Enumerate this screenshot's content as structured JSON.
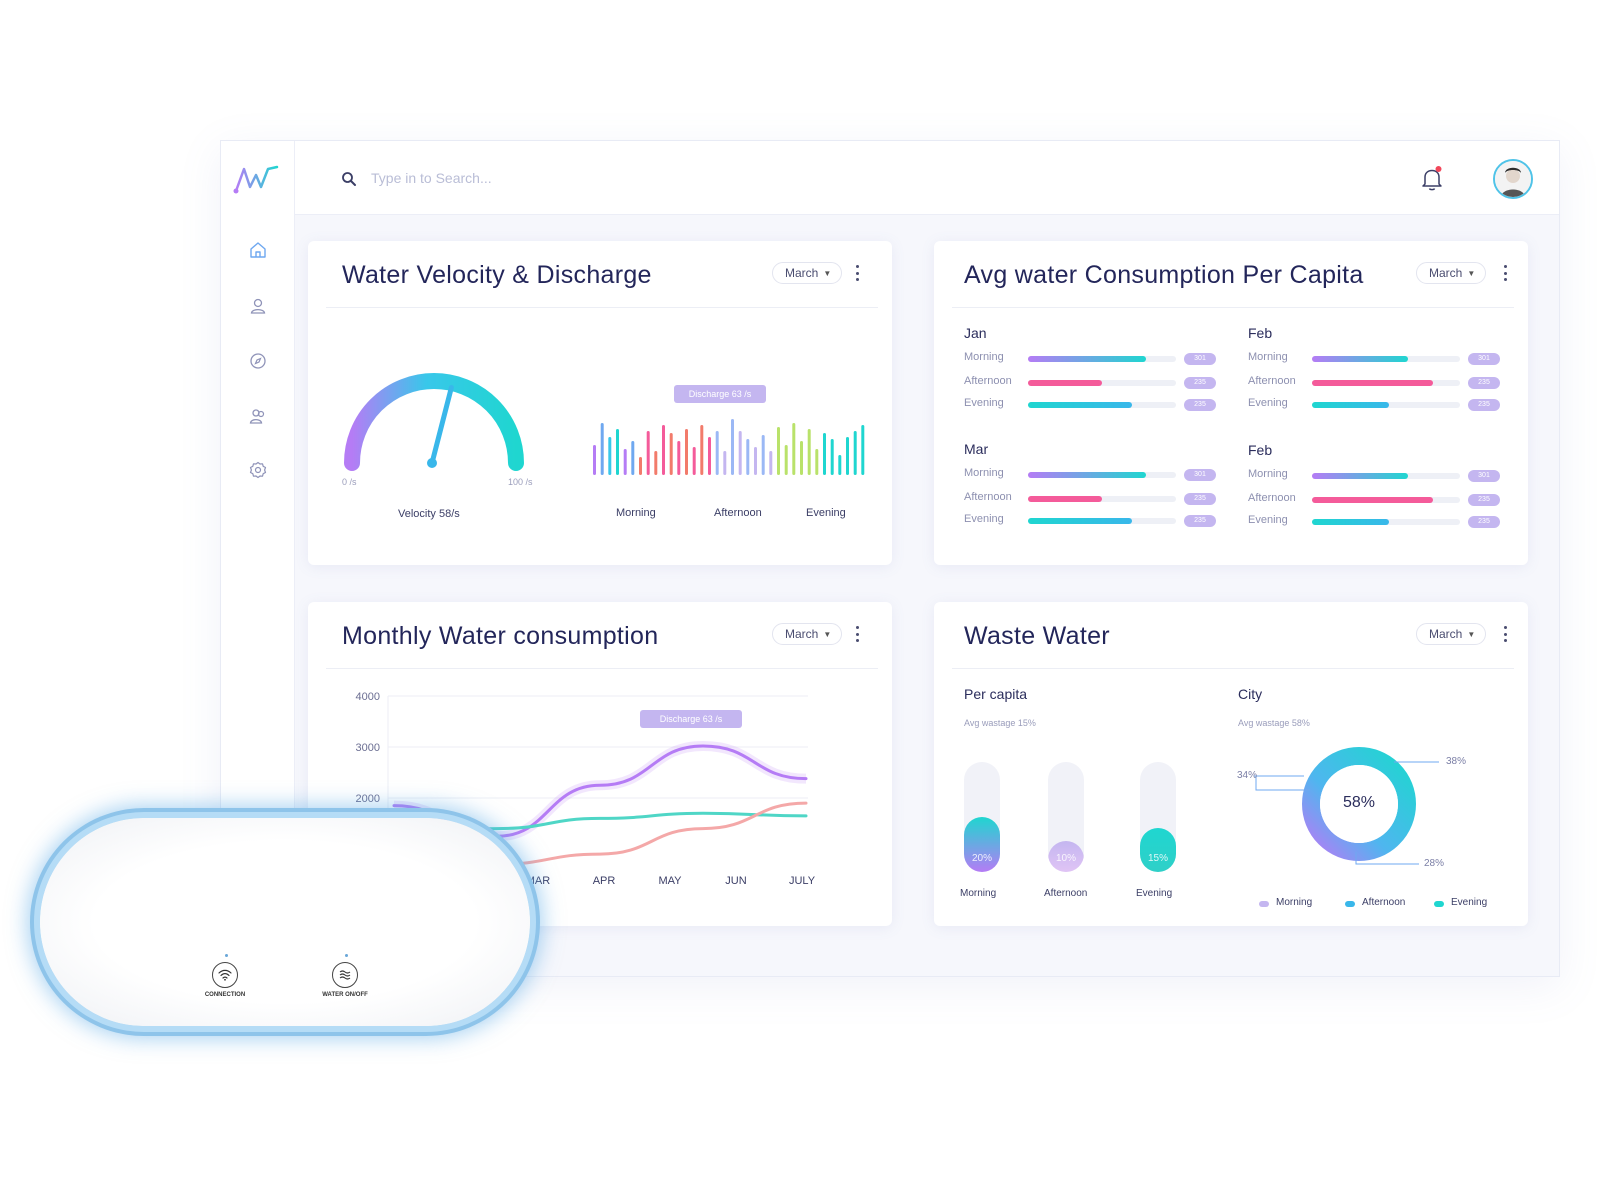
{
  "search": {
    "placeholder": "Type in to Search..."
  },
  "nav": [
    "home-icon",
    "user-icon",
    "compass-icon",
    "users-icon",
    "gear-icon"
  ],
  "colors": {
    "accent_teal": "#1fd6d0",
    "accent_purple": "#b57cf5",
    "accent_pink": "#f45b9a",
    "notification": "#f2475a"
  },
  "velocity_card": {
    "title": "Water Velocity & Discharge",
    "dropdown": "March",
    "gauge": {
      "min_label": "0 /s",
      "max_label": "100 /s",
      "value": 58,
      "caption": "Velocity 58/s"
    },
    "discharge_tooltip": "Discharge 63 /s",
    "bar_labels": [
      "Morning",
      "Afternoon",
      "Evening"
    ]
  },
  "consumption_card": {
    "title": "Avg water Consumption Per Capita",
    "dropdown": "March",
    "groups": [
      {
        "title": "Jan",
        "rows": [
          {
            "label": "Morning",
            "fill": 0.8,
            "badge": "301"
          },
          {
            "label": "Afternoon",
            "fill": 0.5,
            "badge": "235"
          },
          {
            "label": "Evening",
            "fill": 0.7,
            "badge": "235"
          }
        ]
      },
      {
        "title": "Feb",
        "rows": [
          {
            "label": "Morning",
            "fill": 0.65,
            "badge": "301"
          },
          {
            "label": "Afternoon",
            "fill": 0.82,
            "badge": "235"
          },
          {
            "label": "Evening",
            "fill": 0.52,
            "badge": "235"
          }
        ]
      },
      {
        "title": "Mar",
        "rows": [
          {
            "label": "Morning",
            "fill": 0.8,
            "badge": "301"
          },
          {
            "label": "Afternoon",
            "fill": 0.5,
            "badge": "235"
          },
          {
            "label": "Evening",
            "fill": 0.7,
            "badge": "235"
          }
        ]
      },
      {
        "title": "Feb",
        "rows": [
          {
            "label": "Morning",
            "fill": 0.65,
            "badge": "301"
          },
          {
            "label": "Afternoon",
            "fill": 0.82,
            "badge": "235"
          },
          {
            "label": "Evening",
            "fill": 0.52,
            "badge": "235"
          }
        ]
      }
    ]
  },
  "monthly_card": {
    "title": "Monthly Water consumption",
    "dropdown": "March",
    "tooltip": "Discharge 63 /s"
  },
  "waste_card": {
    "title": "Waste Water",
    "dropdown": "March",
    "per_capita": {
      "title": "Per capita",
      "subtitle": "Avg wastage 15%",
      "bars": [
        {
          "label": "Morning",
          "pct": "20%",
          "value": 0.5
        },
        {
          "label": "Afternoon",
          "pct": "10%",
          "value": 0.28
        },
        {
          "label": "Evening",
          "pct": "15%",
          "value": 0.4
        }
      ]
    },
    "city": {
      "title": "City",
      "subtitle": "Avg wastage 58%",
      "center": "58%",
      "callouts": [
        "34%",
        "38%",
        "28%"
      ],
      "legend": [
        "Morning",
        "Afternoon",
        "Evening"
      ]
    }
  },
  "chart_data": {
    "type": "line",
    "x": [
      "MAR",
      "APR",
      "MAY",
      "JUN",
      "JULY"
    ],
    "ylim": [
      0,
      4000
    ],
    "yticks": [
      "4000",
      "3000",
      "2000"
    ],
    "series": [
      {
        "color": "#b57cf5",
        "values": [
          1850,
          1250,
          2250,
          3020,
          2380
        ]
      },
      {
        "color": "#4fd6c6",
        "values": [
          1250,
          1400,
          1600,
          1700,
          1650
        ]
      },
      {
        "color": "#f4a8a8",
        "values": [
          800,
          700,
          900,
          1400,
          1900
        ]
      }
    ]
  },
  "device": {
    "buttons": [
      "CONNECTION",
      "WATER ON/OFF"
    ]
  }
}
